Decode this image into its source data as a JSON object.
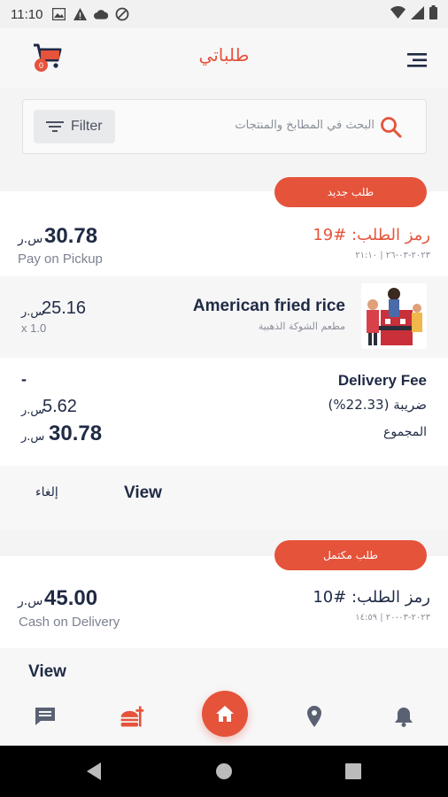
{
  "status_bar": {
    "time": "11:10"
  },
  "app": {
    "title": "طلباتي",
    "cart_count": "0"
  },
  "search": {
    "filter_label": "Filter",
    "placeholder": "البحث في المطابخ والمنتجات"
  },
  "orders": [
    {
      "status_label": "طلب جديد",
      "code_label": "رمز الطلب: #19",
      "date": "٢٠٢٣-٠٣-٢٦ | ٢١:١٠",
      "total": "30.78",
      "currency": "س.ر",
      "payment_method": "Pay on Pickup",
      "items": [
        {
          "name": "American fried rice",
          "restaurant": "مطعم الشوكة الذهبية",
          "price": "25.16",
          "currency": "س.ر",
          "qty": "x 1.0"
        }
      ],
      "summary": {
        "delivery_fee_label": "Delivery Fee",
        "delivery_fee_value": "-",
        "tax_label": "ضريبة (22.33%)",
        "tax_value": "5.62",
        "total_label": "المجموع",
        "total_value": "30.78",
        "currency": "س.ر"
      },
      "actions": {
        "view": "View",
        "cancel": "إلغاء"
      }
    },
    {
      "status_label": "طلب مكتمل",
      "code_label": "رمز الطلب: #10",
      "date": "٢٠٢٣-٠٣-٢٠ | ١٤:٥٩",
      "total": "45.00",
      "currency": "س.ر",
      "payment_method": "Cash on Delivery",
      "actions": {
        "view": "View"
      }
    }
  ],
  "bottom_nav": [
    "chat-icon",
    "food-icon",
    "home-icon",
    "location-icon",
    "bell-icon"
  ],
  "colors": {
    "accent": "#e5533b",
    "text_dark": "#1f2a44",
    "muted": "#7c8290"
  }
}
